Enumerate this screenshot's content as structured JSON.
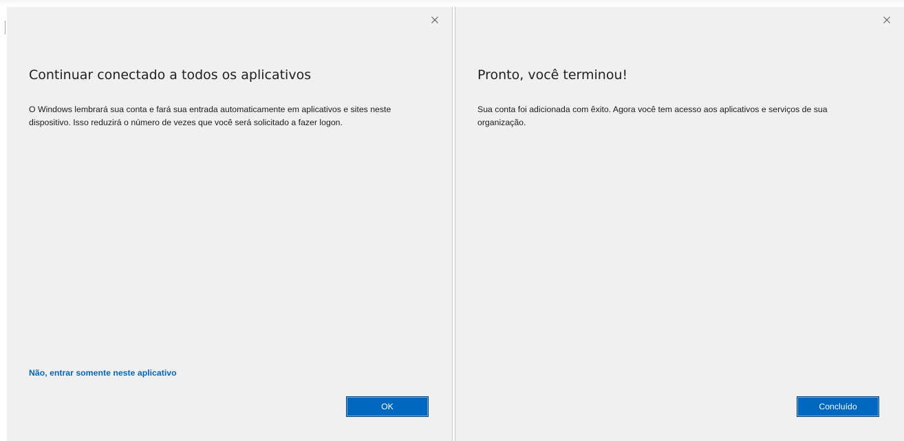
{
  "left_dialog": {
    "title": "Continuar conectado a todos os aplicativos",
    "body": "O Windows lembrará sua conta e fará sua entrada automaticamente em aplicativos e sites neste dispositivo. Isso reduzirá o número de vezes que você será solicitado a fazer logon.",
    "link": "Não, entrar somente neste aplicativo",
    "ok_label": "OK",
    "close_icon": "close-icon"
  },
  "right_dialog": {
    "title": "Pronto, você terminou!",
    "body": "Sua conta foi adicionada com êxito. Agora você tem acesso aos aplicativos e serviços de sua organização.",
    "done_label": "Concluído",
    "close_icon": "close-icon"
  },
  "colors": {
    "dialog_background": "#f0f0f0",
    "accent": "#0067c0",
    "link": "#0a64b4"
  }
}
